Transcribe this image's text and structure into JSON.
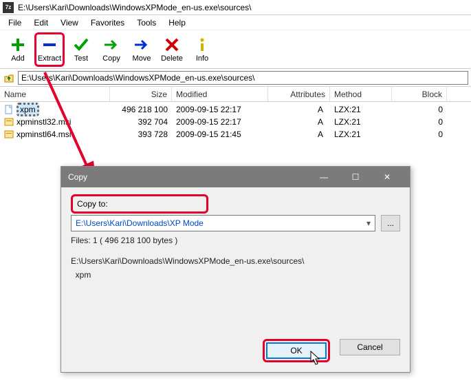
{
  "window": {
    "title": "E:\\Users\\Kari\\Downloads\\WindowsXPMode_en-us.exe\\sources\\",
    "app_icon": "7z"
  },
  "menu": {
    "items": [
      "File",
      "Edit",
      "View",
      "Favorites",
      "Tools",
      "Help"
    ]
  },
  "toolbar": {
    "add": "Add",
    "extract": "Extract",
    "test": "Test",
    "copy": "Copy",
    "move": "Move",
    "delete": "Delete",
    "info": "Info"
  },
  "address": {
    "path": "E:\\Users\\Kari\\Downloads\\WindowsXPMode_en-us.exe\\sources\\"
  },
  "columns": {
    "name": "Name",
    "size": "Size",
    "modified": "Modified",
    "attributes": "Attributes",
    "method": "Method",
    "block": "Block"
  },
  "files": [
    {
      "name": "xpm",
      "size": "496 218 100",
      "modified": "2009-09-15 22:17",
      "attr": "A",
      "method": "LZX:21",
      "block": "0",
      "icon": "file",
      "selected": true
    },
    {
      "name": "xpminstl32.msi",
      "size": "392 704",
      "modified": "2009-09-15 22:17",
      "attr": "A",
      "method": "LZX:21",
      "block": "0",
      "icon": "msi",
      "selected": false
    },
    {
      "name": "xpminstl64.msi",
      "size": "393 728",
      "modified": "2009-09-15 21:45",
      "attr": "A",
      "method": "LZX:21",
      "block": "0",
      "icon": "msi",
      "selected": false
    }
  ],
  "dialog": {
    "title": "Copy",
    "copy_to_label": "Copy to:",
    "destination": "E:\\Users\\Kari\\Downloads\\XP Mode",
    "browse": "...",
    "files_line": "Files: 1   ( 496 218 100 bytes )",
    "source_line1": "E:\\Users\\Kari\\Downloads\\WindowsXPMode_en-us.exe\\sources\\",
    "source_line2": "  xpm",
    "ok": "OK",
    "cancel": "Cancel"
  },
  "icons": {
    "minimize": "—",
    "maximize": "☐",
    "close": "✕"
  }
}
